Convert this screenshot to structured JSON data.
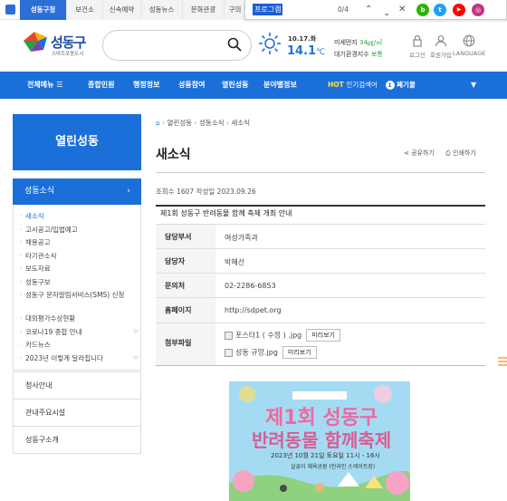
{
  "top_tabs": [
    {
      "label": "성동구청",
      "active": true
    },
    {
      "label": "보건소",
      "active": false
    },
    {
      "label": "신속예약",
      "active": false
    },
    {
      "label": "성동뉴스",
      "active": false
    },
    {
      "label": "문화관광",
      "active": false
    },
    {
      "label": "구의",
      "active": false
    }
  ],
  "find_bar": {
    "query": "프로그램",
    "count": "0/4"
  },
  "social": [
    {
      "name": "blog",
      "glyph": "b",
      "color": "#2db400"
    },
    {
      "name": "twitter",
      "glyph": "t",
      "color": "#1da1f2"
    },
    {
      "name": "youtube",
      "glyph": "▶",
      "color": "#ff0000"
    },
    {
      "name": "instagram",
      "glyph": "◎",
      "color": "#c13584"
    }
  ],
  "logo": {
    "name": "성동구",
    "sub": "스마트포용도시"
  },
  "weather": {
    "date": "10.17.화",
    "temp": "14.1",
    "unit": "℃"
  },
  "dust": {
    "line1_label": "미세먼지",
    "line1_value": "34",
    "line1_unit": "㎍/㎥",
    "line2_label": "대기환경지수",
    "line2_value": "보통"
  },
  "header_links": [
    "로그인",
    "회원가입",
    "LANGUAGE"
  ],
  "nav": {
    "all_menu": "전체메뉴",
    "items": [
      "종합민원",
      "행정정보",
      "성동참여",
      "열린성동",
      "분야별정보"
    ],
    "hot_label": "HOT",
    "hot_text": "인기검색어",
    "rank": "1",
    "keyword": "폐기물"
  },
  "sidebar": {
    "title": "열린성동",
    "section": "성동소식",
    "items": [
      {
        "label": "새소식",
        "selected": true,
        "arrow": false
      },
      {
        "label": "고시공고/입법예고",
        "selected": false,
        "arrow": false
      },
      {
        "label": "채용공고",
        "selected": false,
        "arrow": false
      },
      {
        "label": "타기관소식",
        "selected": false,
        "arrow": false
      },
      {
        "label": "보도자료",
        "selected": false,
        "arrow": false
      },
      {
        "label": "성동구보",
        "selected": false,
        "arrow": false
      },
      {
        "label": "성동구 문자알림서비스(SMS) 신청",
        "selected": false,
        "arrow": false
      },
      {
        "label": "대외평가수상현황",
        "selected": false,
        "arrow": false
      },
      {
        "label": "코로나19 종합 안내",
        "selected": false,
        "arrow": true
      },
      {
        "label": "카드뉴스",
        "selected": false,
        "arrow": false
      },
      {
        "label": "2023년 이렇게 달라집니다",
        "selected": false,
        "arrow": true
      }
    ],
    "menus": [
      "청사안내",
      "관내주요시설",
      "성동구소개"
    ]
  },
  "breadcrumb": [
    "열린성동",
    "성동소식",
    "새소식"
  ],
  "page_title": "새소식",
  "tools": {
    "share": "공유하기",
    "print": "인쇄하기"
  },
  "meta": {
    "views_label": "조회수",
    "views": "1607",
    "date_label": "작성일",
    "date": "2023.09.26"
  },
  "post": {
    "title": "제1회 성동구 반려동물 함께 축제 개최 안내",
    "rows": [
      {
        "label": "담당부서",
        "value": "여성가족과"
      },
      {
        "label": "담당자",
        "value": "박혜선"
      },
      {
        "label": "문의처",
        "value": "02-2286-6853"
      },
      {
        "label": "홈페이지",
        "value": "http://sdpet.org"
      }
    ],
    "files_label": "첨부파일",
    "files": [
      {
        "name": "포스터1 ( 수정 ) .jpg",
        "preview": "미리보기"
      },
      {
        "name": "성동 규앙.jpg",
        "preview": "미리보기"
      }
    ]
  },
  "poster": {
    "title1": "제1회 성동구",
    "title2": "반려동물 함께축제",
    "date": "2023년 10월 21일 토요일 11시 - 16시",
    "place": "살곶이 체육공원 (인라인 스케이트장)"
  }
}
